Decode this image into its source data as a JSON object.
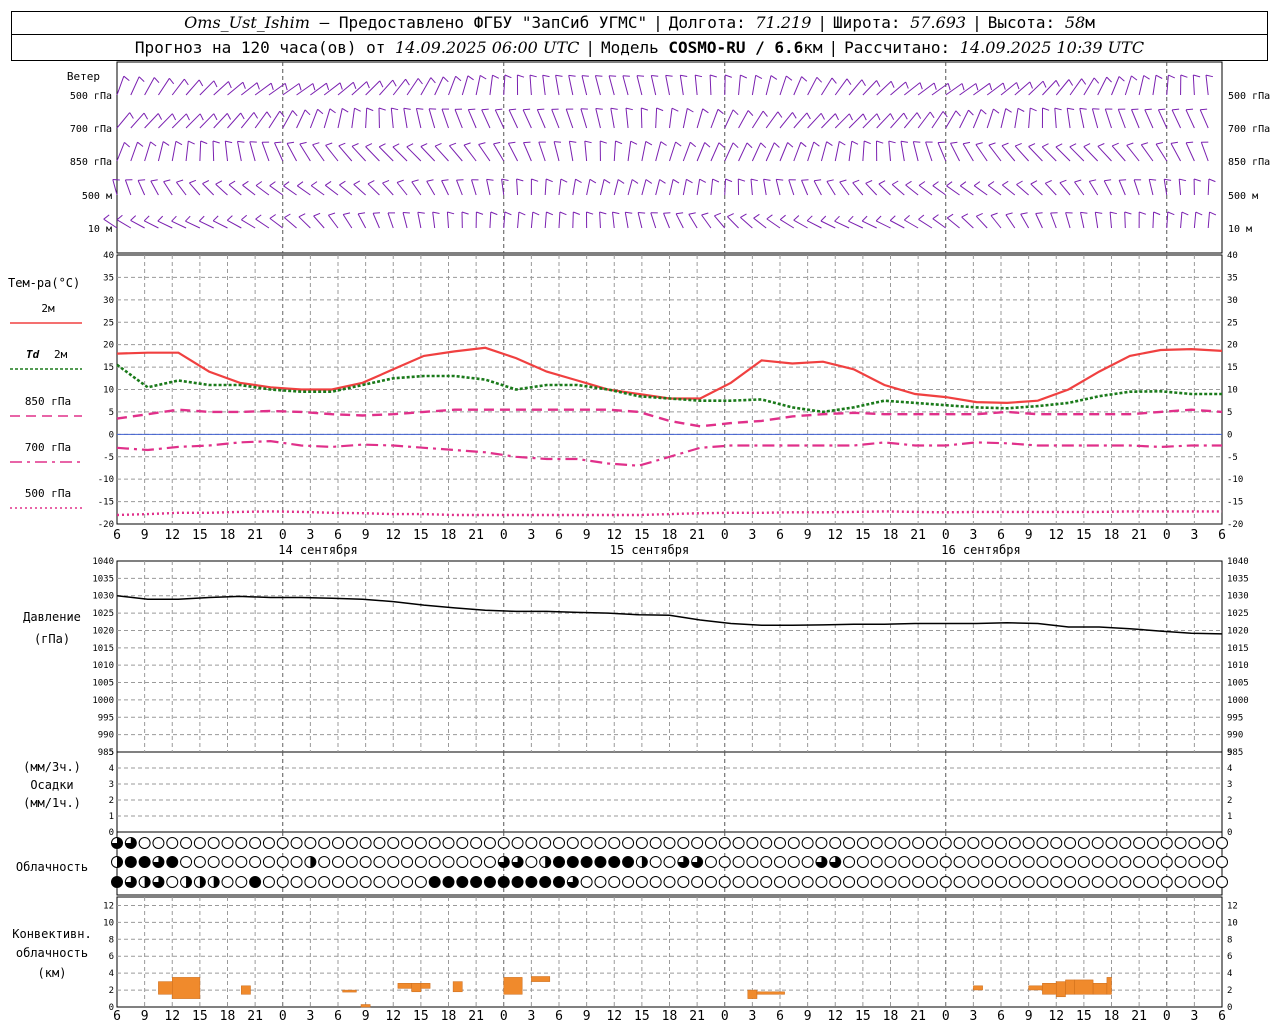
{
  "header": {
    "station": "Oms_Ust_Ishim",
    "provided_by": "– Предоставлено ФГБУ \"ЗапСиб УГМС\"",
    "lon_label": "Долгота:",
    "lon": "71.219",
    "lat_label": "Широта:",
    "lat": "57.693",
    "alt_label": "Высота:",
    "alt": "58",
    "alt_unit": "м",
    "forecast_prefix": "Прогноз на 120 часа(ов) от",
    "forecast_from": "14.09.2025 06:00 UTC",
    "model_label": "Модель",
    "model": "COSMO-RU / 6.6",
    "model_unit": "км",
    "computed_label": "Рассчитано:",
    "computed": "14.09.2025 10:39 UTC"
  },
  "wind_panel": {
    "title": "Ветер",
    "levels": [
      "500 гПа",
      "700 гПа",
      "850 гПа",
      "500 м",
      "10  м"
    ]
  },
  "temp_panel": {
    "title": "Тем-ра(°C)",
    "legend": [
      {
        "label": "2м",
        "color": "#f04040",
        "style": "solid"
      },
      {
        "label_italic": "Td",
        "label": "2м",
        "color": "#1a7a1a",
        "style": "dotted"
      },
      {
        "label": "850 гПа",
        "color": "#e0308a",
        "style": "dashed"
      },
      {
        "label": "700 гПа",
        "color": "#e0308a",
        "style": "dashdot"
      },
      {
        "label": "500 гПа",
        "color": "#e0308a",
        "style": "dotted"
      }
    ]
  },
  "pressure_panel": {
    "title_1": "Давление",
    "title_2": "(гПа)"
  },
  "precip_panel": {
    "label_1": "(мм/3ч.)",
    "label_2": "Осадки",
    "label_3": "(мм/1ч.)"
  },
  "cloud_panel": {
    "title": "Облачность"
  },
  "conv_panel": {
    "title_1": "Конвективн.",
    "title_2": "облачность",
    "title_3": "(км)"
  },
  "chart_data": [
    {
      "type": "line",
      "title": "Тем-ра(°C)",
      "x_hours": [
        0,
        3,
        6,
        9,
        12,
        15,
        18,
        21,
        24,
        27,
        30,
        33,
        36,
        39,
        42,
        45,
        48,
        51,
        54,
        57,
        60,
        63,
        66,
        69,
        72,
        75,
        78,
        81,
        84,
        87,
        90,
        93,
        96,
        99,
        102,
        105,
        108,
        111,
        114,
        117,
        120
      ],
      "x_tick_labels": [
        "6",
        "9",
        "12",
        "15",
        "18",
        "21",
        "0",
        "3",
        "6",
        "9",
        "12",
        "15",
        "18",
        "21",
        "0",
        "3",
        "6",
        "9",
        "12",
        "15",
        "18",
        "21",
        "0",
        "3",
        "6",
        "9",
        "12"
      ],
      "date_labels": [
        "14 сентября",
        "15 сентября",
        "16 сентября"
      ],
      "ylim": [
        -20,
        40
      ],
      "y_ticks": [
        -20,
        -15,
        -10,
        -5,
        0,
        5,
        10,
        15,
        20,
        25,
        30,
        35,
        40
      ],
      "series": [
        {
          "name": "2м",
          "values": [
            18,
            18.2,
            18.2,
            14,
            11.5,
            10.5,
            10,
            10,
            11.5,
            14.5,
            17.5,
            18.5,
            19.3,
            17,
            14,
            12,
            10,
            9,
            8,
            8,
            11.5,
            16.5,
            15.8,
            16.2,
            14.5,
            11,
            9,
            8.3,
            7.2,
            7,
            7.5,
            10,
            14,
            17.5,
            18.8,
            19,
            18.6
          ]
        },
        {
          "name": "Td 2м",
          "values": [
            15.5,
            10.5,
            12,
            11,
            11,
            10,
            9.5,
            9.5,
            11,
            12.5,
            13,
            13,
            12.2,
            10,
            11,
            11,
            10,
            8.5,
            8,
            7.5,
            7.5,
            7.8,
            6,
            5,
            6,
            7.5,
            7,
            6.5,
            6,
            5.8,
            6.3,
            7,
            8.5,
            9.5,
            9.6,
            9,
            9
          ]
        },
        {
          "name": "850 гПа",
          "values": [
            3.5,
            4.5,
            5.5,
            5,
            5,
            5.2,
            5,
            4.5,
            4.2,
            4.5,
            5,
            5.5,
            5.5,
            5.5,
            5.5,
            5.5,
            5.5,
            5,
            3,
            1.8,
            2.5,
            3,
            4,
            4.5,
            4.8,
            4.5,
            4.5,
            4.5,
            4.5,
            5,
            4.5,
            4.5,
            4.5,
            4.5,
            5,
            5.5,
            5
          ]
        },
        {
          "name": "700 гПа",
          "values": [
            -3,
            -3.5,
            -2.8,
            -2.5,
            -1.8,
            -1.5,
            -2.5,
            -2.8,
            -2.3,
            -2.5,
            -3,
            -3.5,
            -4,
            -5,
            -5.5,
            -5.5,
            -6.5,
            -7,
            -5,
            -3,
            -2.5,
            -2.5,
            -2.5,
            -2.5,
            -2.5,
            -1.8,
            -2.5,
            -2.5,
            -1.8,
            -2,
            -2.5,
            -2.5,
            -2.5,
            -2.5,
            -2.8,
            -2.5,
            -2.5
          ]
        },
        {
          "name": "500 гПа",
          "values": [
            -18,
            -17.8,
            -17.5,
            -17.5,
            -17.3,
            -17.2,
            -17.3,
            -17.5,
            -17.6,
            -17.8,
            -17.8,
            -18,
            -18,
            -18,
            -18,
            -18,
            -18,
            -18,
            -17.8,
            -17.6,
            -17.5,
            -17.5,
            -17.4,
            -17.4,
            -17.3,
            -17.2,
            -17.3,
            -17.4,
            -17.3,
            -17.3,
            -17.3,
            -17.3,
            -17.3,
            -17.2,
            -17.2,
            -17.2,
            -17.2
          ]
        }
      ]
    },
    {
      "type": "line",
      "title": "Давление (гПа)",
      "ylim": [
        985,
        1040
      ],
      "y_ticks": [
        985,
        990,
        995,
        1000,
        1005,
        1010,
        1015,
        1020,
        1025,
        1030,
        1035,
        1040
      ],
      "series": [
        {
          "name": "Давление",
          "values": [
            1030,
            1029,
            1029,
            1029.5,
            1029.8,
            1029.5,
            1029.5,
            1029.3,
            1029,
            1028.3,
            1027.3,
            1026.5,
            1025.8,
            1025.5,
            1025.5,
            1025.2,
            1025,
            1024.5,
            1024.4,
            1023,
            1022,
            1021.5,
            1021.5,
            1021.6,
            1021.8,
            1021.8,
            1022,
            1022,
            1022,
            1022.2,
            1022,
            1021,
            1021,
            1020.5,
            1019.8,
            1019.2,
            1019
          ]
        }
      ]
    },
    {
      "type": "bar",
      "title": "Осадки",
      "ylim": [
        0,
        5
      ],
      "y_ticks": [
        0,
        1,
        2,
        3,
        4,
        5
      ],
      "series": [
        {
          "name": "Осадки",
          "values": []
        }
      ]
    },
    {
      "type": "bar",
      "title": "Конвективн. облачность (км)",
      "ylim": [
        0,
        13
      ],
      "y_ticks": [
        0,
        2,
        4,
        6,
        8,
        10,
        12
      ],
      "bars": [
        {
          "h": 4.5,
          "h2": 7.5,
          "base": 1.5,
          "top": 3
        },
        {
          "h": 6,
          "h2": 9,
          "base": 1,
          "top": 3.5
        },
        {
          "h": 13.5,
          "h2": 14.5,
          "base": 1.5,
          "top": 2.5
        },
        {
          "h": 24.5,
          "h2": 26,
          "base": 1.8,
          "top": 2
        },
        {
          "h": 26.5,
          "h2": 27.5,
          "base": 0,
          "top": 0.3
        },
        {
          "h": 30.5,
          "h2": 32,
          "base": 2.2,
          "top": 2.8
        },
        {
          "h": 32,
          "h2": 33,
          "base": 1.8,
          "top": 2.8
        },
        {
          "h": 33,
          "h2": 34,
          "base": 2.2,
          "top": 2.8
        },
        {
          "h": 36.5,
          "h2": 37.5,
          "base": 1.8,
          "top": 3
        },
        {
          "h": 42,
          "h2": 44,
          "base": 1.5,
          "top": 3.5
        },
        {
          "h": 45,
          "h2": 47,
          "base": 3,
          "top": 3.6
        },
        {
          "h": 68.5,
          "h2": 69.5,
          "base": 1,
          "top": 2
        },
        {
          "h": 69.5,
          "h2": 72.5,
          "base": 1.5,
          "top": 1.8
        },
        {
          "h": 93,
          "h2": 94,
          "base": 2,
          "top": 2.5
        },
        {
          "h": 99,
          "h2": 100.5,
          "base": 2,
          "top": 2.5
        },
        {
          "h": 100.5,
          "h2": 102,
          "base": 1.5,
          "top": 2.8
        },
        {
          "h": 102,
          "h2": 103,
          "base": 1.2,
          "top": 3
        },
        {
          "h": 103,
          "h2": 104,
          "base": 1.5,
          "top": 3.2
        },
        {
          "h": 104,
          "h2": 106,
          "base": 1.5,
          "top": 3.2
        },
        {
          "h": 106,
          "h2": 107.5,
          "base": 1.5,
          "top": 2.8
        },
        {
          "h": 107.5,
          "h2": 108,
          "base": 1.5,
          "top": 3.5
        }
      ]
    }
  ],
  "colors": {
    "t2m": "#f04040",
    "td": "#1a7a1a",
    "upper": "#e0308a",
    "wind": "#7a1fb0",
    "conv": "#f08a2c",
    "grid": "#9a9a9a",
    "zero_line": "#4060d0"
  },
  "cloud_rows": [
    "q q e e e e e e e e e e e e e e e e e e e e e e e e e e e e e e e e e e e e e e e e e e e e e e e e e e e e e e e e e e e e e e e e e e e e e e e e e e e e e e e e e e e e e e e e e e e e e e e e e e e e e e e e e e e",
    "h f f q f e e e e e e e e e h e e e e e e e e e e e e e q q e h f f f f f f h e e q q e e e e e e e e q q e e e e e e e e e e e e e e e e e e e e e e e e e e e e e e e e e e e e e e e e e e e e e e e e e e e e e e e e e e e e e e",
    "f q h q e h h h e e f e e e e e e e e e e e e f f f f f f f f f f q e e e e e e e e e e e e e e e e e e e e e e e e e e e e e e e e e e e e e e e e e e e e e e e e e e e e e e e e e e e e e e e e e e e e e e e e e e e e e e"
  ]
}
